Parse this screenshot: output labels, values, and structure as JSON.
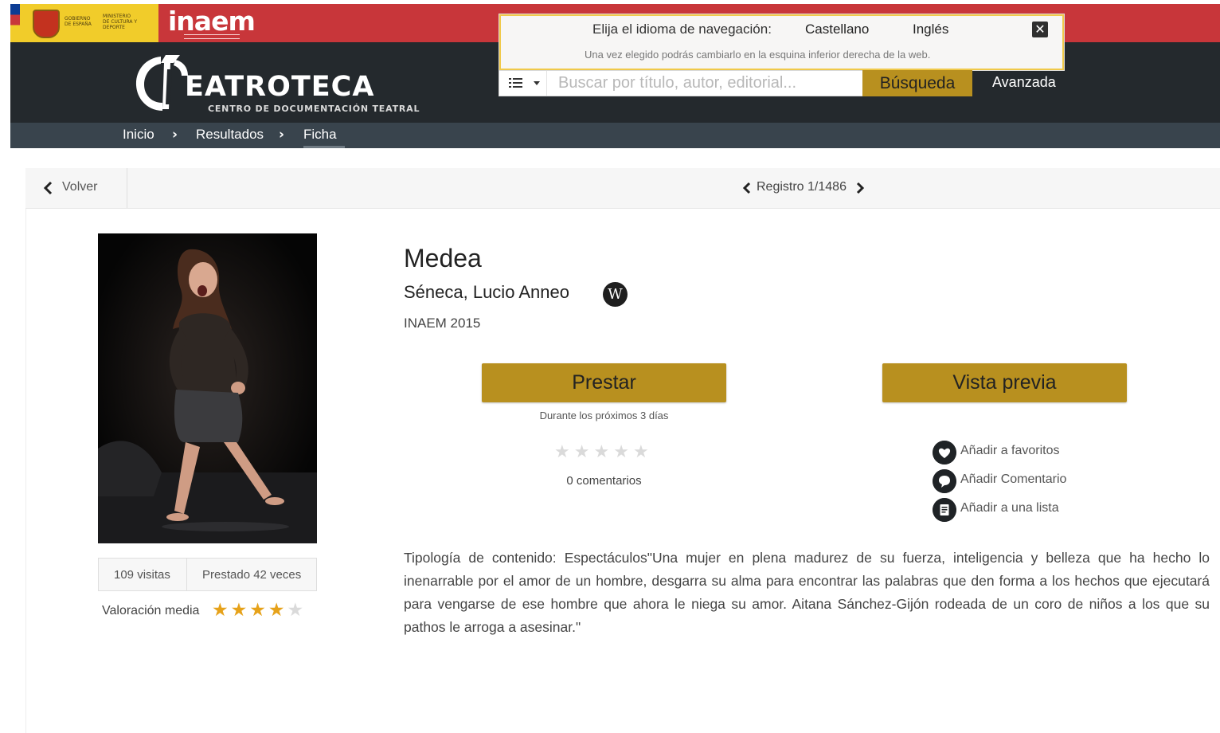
{
  "header": {
    "gov_logo_lines": [
      "GOBIERNO DE ESPAÑA",
      "MINISTERIO DE CULTURA Y DEPORTE"
    ],
    "inaem_logo": "inaem",
    "site_logo": "EATROTECA",
    "site_subtitle": "CENTRO DE DOCUMENTACIÓN TEATRAL",
    "colors": {
      "red": "#c8363a",
      "dark": "#24292d",
      "gold": "#b8901f",
      "breadcrumb_bg": "#39444d"
    }
  },
  "language_popup": {
    "question": "Elija el idioma de navegación:",
    "options": [
      "Castellano",
      "Inglés"
    ],
    "note": "Una vez elegido podrás cambiarlo en la esquina inferior derecha de la web.",
    "close_icon": "close-icon"
  },
  "search": {
    "placeholder": "Buscar por título, autor, editorial...",
    "button_label": "Búsqueda",
    "advanced_label": "Avanzada",
    "menu_icon": "list-icon"
  },
  "breadcrumb": {
    "items": [
      "Inicio",
      "Resultados",
      "Ficha"
    ],
    "separator": "›"
  },
  "record_nav": {
    "back_label": "Volver",
    "record_label": "Registro 1/1486"
  },
  "record": {
    "title": "Medea",
    "author": "Séneca, Lucio Anneo",
    "wiki_icon_letter": "W",
    "publisher": "INAEM 2015",
    "stats": {
      "visits": "109 visitas",
      "loans": "Prestado 42 veces"
    },
    "rating_label": "Valoración media",
    "rating_value": 4,
    "rating_max": 5,
    "user_rating_value": 0,
    "borrow_label": "Prestar",
    "preview_label": "Vista previa",
    "loan_note": "Durante los próximos 3 días",
    "comments_label": "0 comentarios",
    "actions": [
      {
        "label": "Añadir a favoritos",
        "icon": "heart-icon"
      },
      {
        "label": "Añadir Comentario",
        "icon": "comment-icon"
      },
      {
        "label": "Añadir a una lista",
        "icon": "list-add-icon"
      }
    ],
    "description": "Tipología de contenido: Espectáculos\"Una mujer en plena madurez de su fuerza, inteligencia y belleza que ha hecho lo inenarrable por el amor de un hombre, desgarra su alma para encontrar las palabras que den forma a los hechos que ejecutará para vengarse de ese hombre que ahora le niega su amor. Aitana Sánchez-Gijón rodeada de un coro de niños a los que su pathos le arroga a asesinar.\""
  }
}
